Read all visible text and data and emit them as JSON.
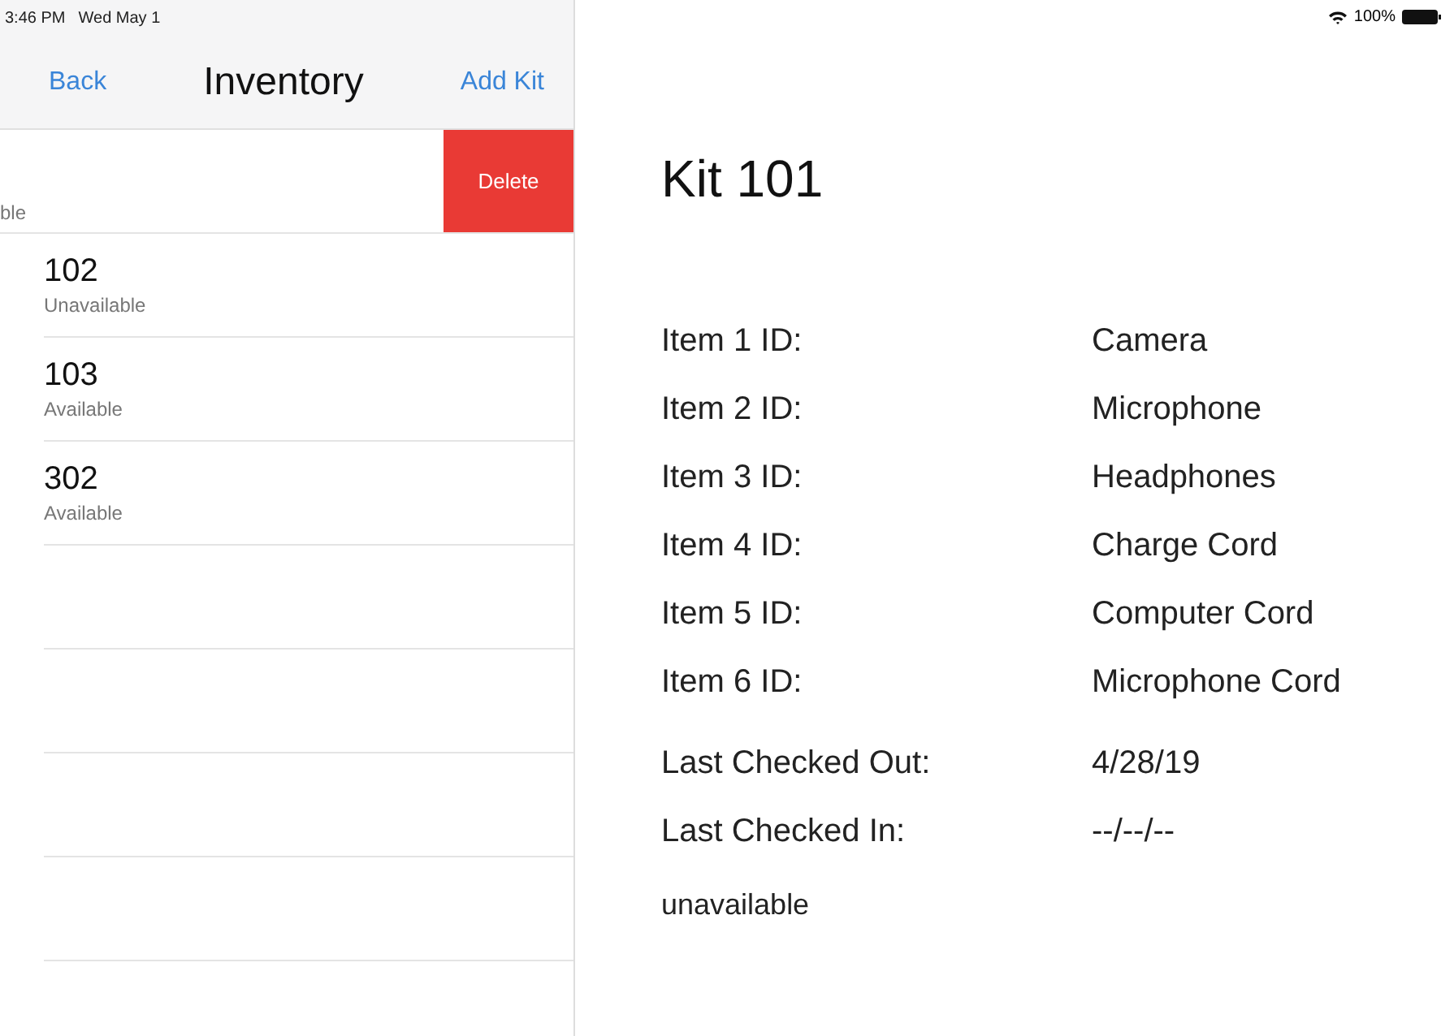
{
  "status_bar": {
    "time": "3:46 PM",
    "date": "Wed May 1",
    "battery": "100%"
  },
  "nav_bar": {
    "back": "Back",
    "title": "Inventory",
    "action": "Add Kit"
  },
  "kits": [
    {
      "kind": "swiped",
      "status": "ble",
      "action": "Delete"
    },
    {
      "kind": "normal",
      "name": "102",
      "status": "Unavailable"
    },
    {
      "kind": "normal",
      "name": "103",
      "status": "Available"
    },
    {
      "kind": "normal",
      "name": "302",
      "status": "Available"
    }
  ],
  "detail": {
    "title": "Kit 101",
    "items": [
      {
        "label": "Item 1 ID:",
        "value": "Camera"
      },
      {
        "label": "Item 2 ID:",
        "value": "Microphone"
      },
      {
        "label": "Item 3 ID:",
        "value": "Headphones"
      },
      {
        "label": "Item 4 ID:",
        "value": "Charge Cord"
      },
      {
        "label": "Item 5 ID:",
        "value": "Computer Cord"
      },
      {
        "label": "Item 6 ID:",
        "value": "Microphone Cord"
      }
    ],
    "dates": [
      {
        "label": "Last Checked Out:",
        "value": "4/28/19"
      },
      {
        "label": "Last Checked In:",
        "value": "--/--/--"
      }
    ],
    "availability": "unavailable"
  }
}
